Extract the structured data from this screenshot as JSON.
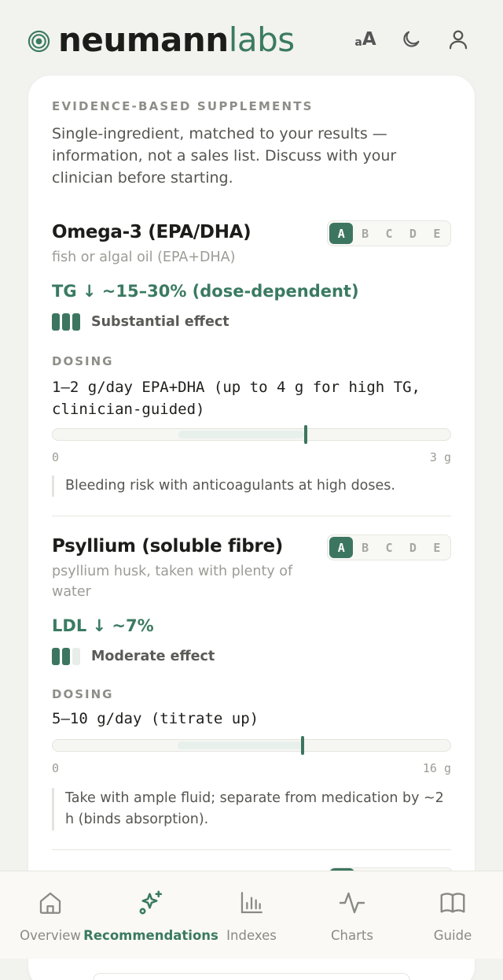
{
  "brand": {
    "name_bold": "neumann",
    "name_light": "labs"
  },
  "header": {
    "fontsize_small": "a",
    "fontsize_big": "A"
  },
  "section": {
    "eyebrow": "EVIDENCE-BASED SUPPLEMENTS",
    "intro": "Single-ingredient, matched to your results — information, not a sales list. Discuss with your clinician before starting."
  },
  "grade_letters": [
    "A",
    "B",
    "C",
    "D",
    "E"
  ],
  "supplements": [
    {
      "name": "Omega-3 (EPA/DHA)",
      "form": "fish or algal oil (EPA+DHA)",
      "grade": "A",
      "effect": "TG ↓ ~15–30% (dose-dependent)",
      "strength_level": 3,
      "strength_max": 3,
      "strength_label": "Substantial effect",
      "dosing_label": "DOSING",
      "dose": "1–2 g/day EPA+DHA (up to 4 g for high TG, clinician-guided)",
      "scale_min": "0",
      "scale_max": "3 g",
      "range_low": 1,
      "range_high": 2,
      "scale_max_value": 3,
      "marker_value": 2,
      "note": "Bleeding risk with anticoagulants at high doses."
    },
    {
      "name": "Psyllium (soluble fibre)",
      "form": "psyllium husk, taken with plenty of water",
      "grade": "A",
      "effect": "LDL ↓ ~7%",
      "strength_level": 2,
      "strength_max": 3,
      "strength_label": "Moderate effect",
      "dosing_label": "DOSING",
      "dose": "5–10 g/day (titrate up)",
      "scale_min": "0",
      "scale_max": "16 g",
      "range_low": 5,
      "range_high": 10,
      "scale_max_value": 16,
      "marker_value": 10,
      "note": "Take with ample fluid; separate from medication by ~2 h (binds absorption)."
    }
  ],
  "nav": {
    "items": [
      {
        "label": "Overview",
        "icon": "home-icon",
        "active": false
      },
      {
        "label": "Recommendations",
        "icon": "sparkle-icon",
        "active": true
      },
      {
        "label": "Indexes",
        "icon": "bar-chart-icon",
        "active": false
      },
      {
        "label": "Charts",
        "icon": "pulse-icon",
        "active": false
      },
      {
        "label": "Guide",
        "icon": "book-icon",
        "active": false
      }
    ]
  },
  "colors": {
    "accent": "#3d7660",
    "accent_text": "#3a7a62",
    "background": "#f2f2ee",
    "card": "#ffffff"
  }
}
